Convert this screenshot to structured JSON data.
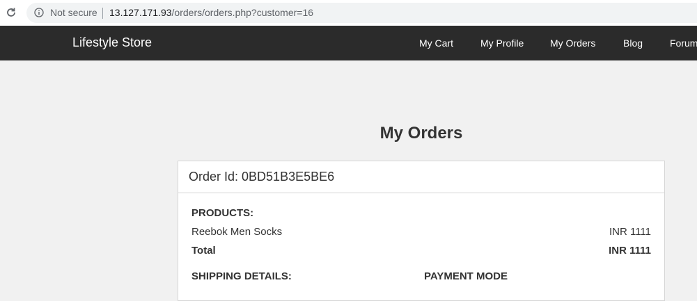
{
  "browser": {
    "security_label": "Not secure",
    "url_host": "13.127.171.93",
    "url_path": "/orders/orders.php?customer=16",
    "icons": {
      "reload": "reload-icon",
      "info": "info-icon"
    }
  },
  "navbar": {
    "brand": "Lifestyle Store",
    "links": [
      "My Cart",
      "My Profile",
      "My Orders",
      "Blog",
      "Forum"
    ],
    "background": "#2b2b2b"
  },
  "page": {
    "title": "My Orders"
  },
  "order": {
    "id_label": "Order Id: 0BD51B3E5BE6",
    "products_heading": "PRODUCTS:",
    "product_name": "Reebok Men Socks",
    "product_price": "INR 1111",
    "total_label": "Total",
    "total_value": "INR 1111",
    "shipping_heading": "SHIPPING DETAILS:",
    "payment_heading": "PAYMENT MODE"
  }
}
